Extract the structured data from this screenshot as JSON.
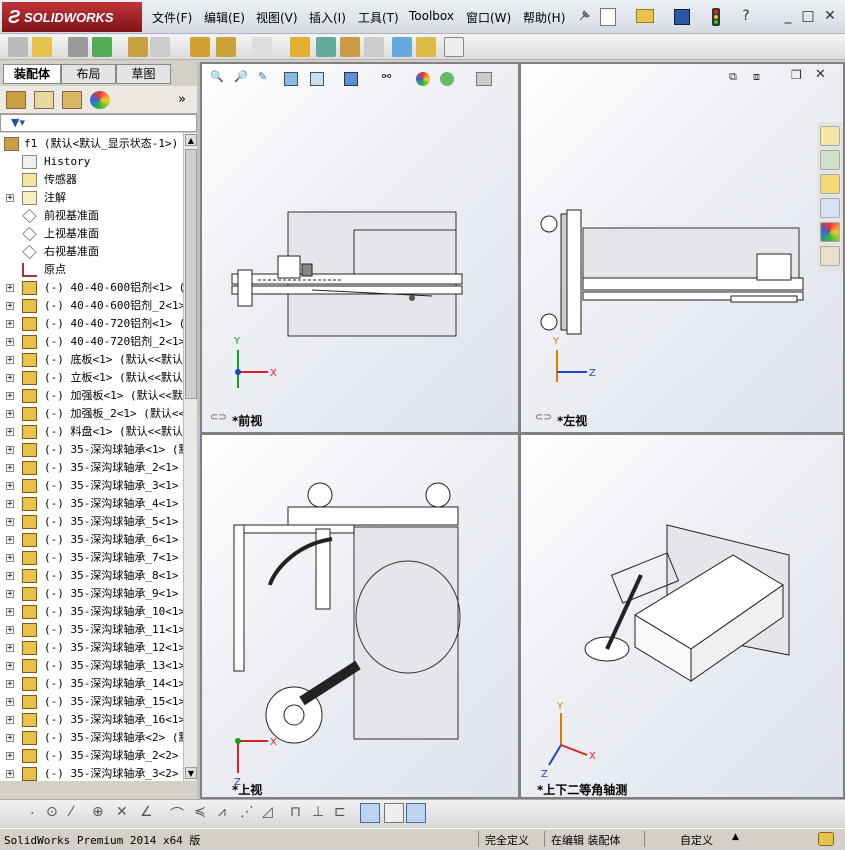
{
  "app": {
    "logo_text": "SOLIDWORKS",
    "brand_color": "#b5272d"
  },
  "menu": [
    "文件(F)",
    "编辑(E)",
    "视图(V)",
    "插入(I)",
    "工具(T)",
    "Toolbox",
    "窗口(W)",
    "帮助(H)"
  ],
  "window_controls": {
    "minimize": "_",
    "restore": "□",
    "close": "✕",
    "help": "?"
  },
  "tabs": [
    "装配体",
    "布局",
    "草图"
  ],
  "tree": {
    "root": "f1  (默认<默认_显示状态-1>)",
    "items": [
      {
        "type": "history",
        "label": "History",
        "expand": false
      },
      {
        "type": "sensor",
        "label": "传感器",
        "expand": false
      },
      {
        "type": "annotation",
        "label": "注解",
        "expand": true
      },
      {
        "type": "plane",
        "label": "前视基准面",
        "expand": false
      },
      {
        "type": "plane",
        "label": "上视基准面",
        "expand": false
      },
      {
        "type": "plane",
        "label": "右视基准面",
        "expand": false
      },
      {
        "type": "origin",
        "label": "原点",
        "expand": false
      },
      {
        "type": "part",
        "label": "(-) 40-40-600铝剂<1> (默",
        "expand": true
      },
      {
        "type": "part",
        "label": "(-) 40-40-600铝剂_2<1>",
        "expand": true
      },
      {
        "type": "part",
        "label": "(-) 40-40-720铝剂<1> (默",
        "expand": true
      },
      {
        "type": "part",
        "label": "(-) 40-40-720铝剂_2<1>",
        "expand": true
      },
      {
        "type": "part",
        "label": "(-) 底板<1> (默认<<默认",
        "expand": true
      },
      {
        "type": "part",
        "label": "(-) 立板<1> (默认<<默认",
        "expand": true
      },
      {
        "type": "part",
        "label": "(-) 加强板<1> (默认<<默",
        "expand": true
      },
      {
        "type": "part",
        "label": "(-) 加强板_2<1> (默认<<",
        "expand": true
      },
      {
        "type": "part",
        "label": "(-) 料盘<1> (默认<<默认",
        "expand": true
      },
      {
        "type": "part",
        "label": "(-) 35-深沟球轴承<1> (默",
        "expand": true
      },
      {
        "type": "part",
        "label": "(-) 35-深沟球轴承_2<1>",
        "expand": true
      },
      {
        "type": "part",
        "label": "(-) 35-深沟球轴承_3<1>",
        "expand": true
      },
      {
        "type": "part",
        "label": "(-) 35-深沟球轴承_4<1>",
        "expand": true
      },
      {
        "type": "part",
        "label": "(-) 35-深沟球轴承_5<1>",
        "expand": true
      },
      {
        "type": "part",
        "label": "(-) 35-深沟球轴承_6<1>",
        "expand": true
      },
      {
        "type": "part",
        "label": "(-) 35-深沟球轴承_7<1>",
        "expand": true
      },
      {
        "type": "part",
        "label": "(-) 35-深沟球轴承_8<1>",
        "expand": true
      },
      {
        "type": "part",
        "label": "(-) 35-深沟球轴承_9<1>",
        "expand": true
      },
      {
        "type": "part",
        "label": "(-) 35-深沟球轴承_10<1>",
        "expand": true
      },
      {
        "type": "part",
        "label": "(-) 35-深沟球轴承_11<1>",
        "expand": true
      },
      {
        "type": "part",
        "label": "(-) 35-深沟球轴承_12<1>",
        "expand": true
      },
      {
        "type": "part",
        "label": "(-) 35-深沟球轴承_13<1>",
        "expand": true
      },
      {
        "type": "part",
        "label": "(-) 35-深沟球轴承_14<1>",
        "expand": true
      },
      {
        "type": "part",
        "label": "(-) 35-深沟球轴承_15<1>",
        "expand": true
      },
      {
        "type": "part",
        "label": "(-) 35-深沟球轴承_16<1>",
        "expand": true
      },
      {
        "type": "part",
        "label": "(-) 35-深沟球轴承<2> (默",
        "expand": true
      },
      {
        "type": "part",
        "label": "(-) 35-深沟球轴承_2<2>",
        "expand": true
      },
      {
        "type": "part",
        "label": "(-) 35-深沟球轴承_3<2>",
        "expand": true
      }
    ]
  },
  "viewports": {
    "front": {
      "label": "*前视",
      "axes": [
        "Y",
        "X"
      ]
    },
    "left": {
      "label": "*左视",
      "axes": [
        "Y",
        "Z"
      ]
    },
    "top": {
      "label": "*上视",
      "axes": [
        "X",
        "Z"
      ]
    },
    "iso": {
      "label": "*上下二等角轴测",
      "axes": [
        "Y",
        "X",
        "Z"
      ]
    }
  },
  "status": {
    "version": "SolidWorks Premium 2014 x64 版",
    "definition": "完全定义",
    "editing": "在编辑 装配体",
    "custom": "自定义"
  }
}
